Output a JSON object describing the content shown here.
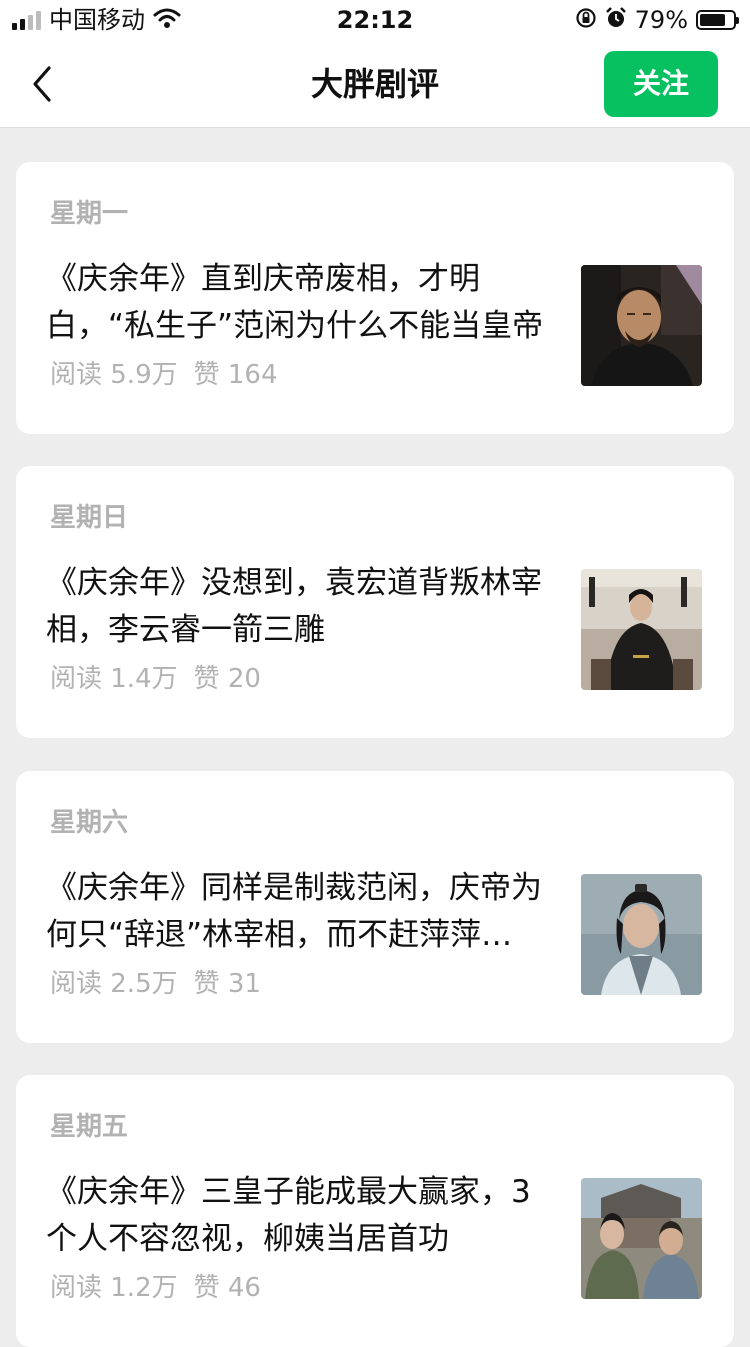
{
  "status_bar": {
    "carrier": "中国移动",
    "time": "22:12",
    "battery": "79%",
    "battery_level": 0.79,
    "icons": [
      "signal-icon",
      "wifi-icon",
      "rotation-lock-icon",
      "alarm-icon",
      "battery-icon"
    ]
  },
  "nav": {
    "title": "大胖剧评",
    "follow_label": "关注",
    "accent": "#07c160"
  },
  "articles": [
    {
      "weekday": "星期一",
      "title": "《庆余年》直到庆帝废相，才明白，“私生子”范闲为什么不能当皇帝",
      "reads": "阅读 5.9万",
      "likes": "赞 164"
    },
    {
      "weekday": "星期日",
      "title": "《庆余年》没想到，袁宏道背叛林宰相，李云睿一箭三雕",
      "reads": "阅读 1.4万",
      "likes": "赞 20"
    },
    {
      "weekday": "星期六",
      "title": "《庆余年》同样是制裁范闲，庆帝为何只“辞退”林宰相，而不赶萍萍…",
      "reads": "阅读 2.5万",
      "likes": "赞 31"
    },
    {
      "weekday": "星期五",
      "title": "《庆余年》三皇子能成最大赢家，3个人不容忽视，柳姨当居首功",
      "reads": "阅读 1.2万",
      "likes": "赞 46"
    }
  ]
}
